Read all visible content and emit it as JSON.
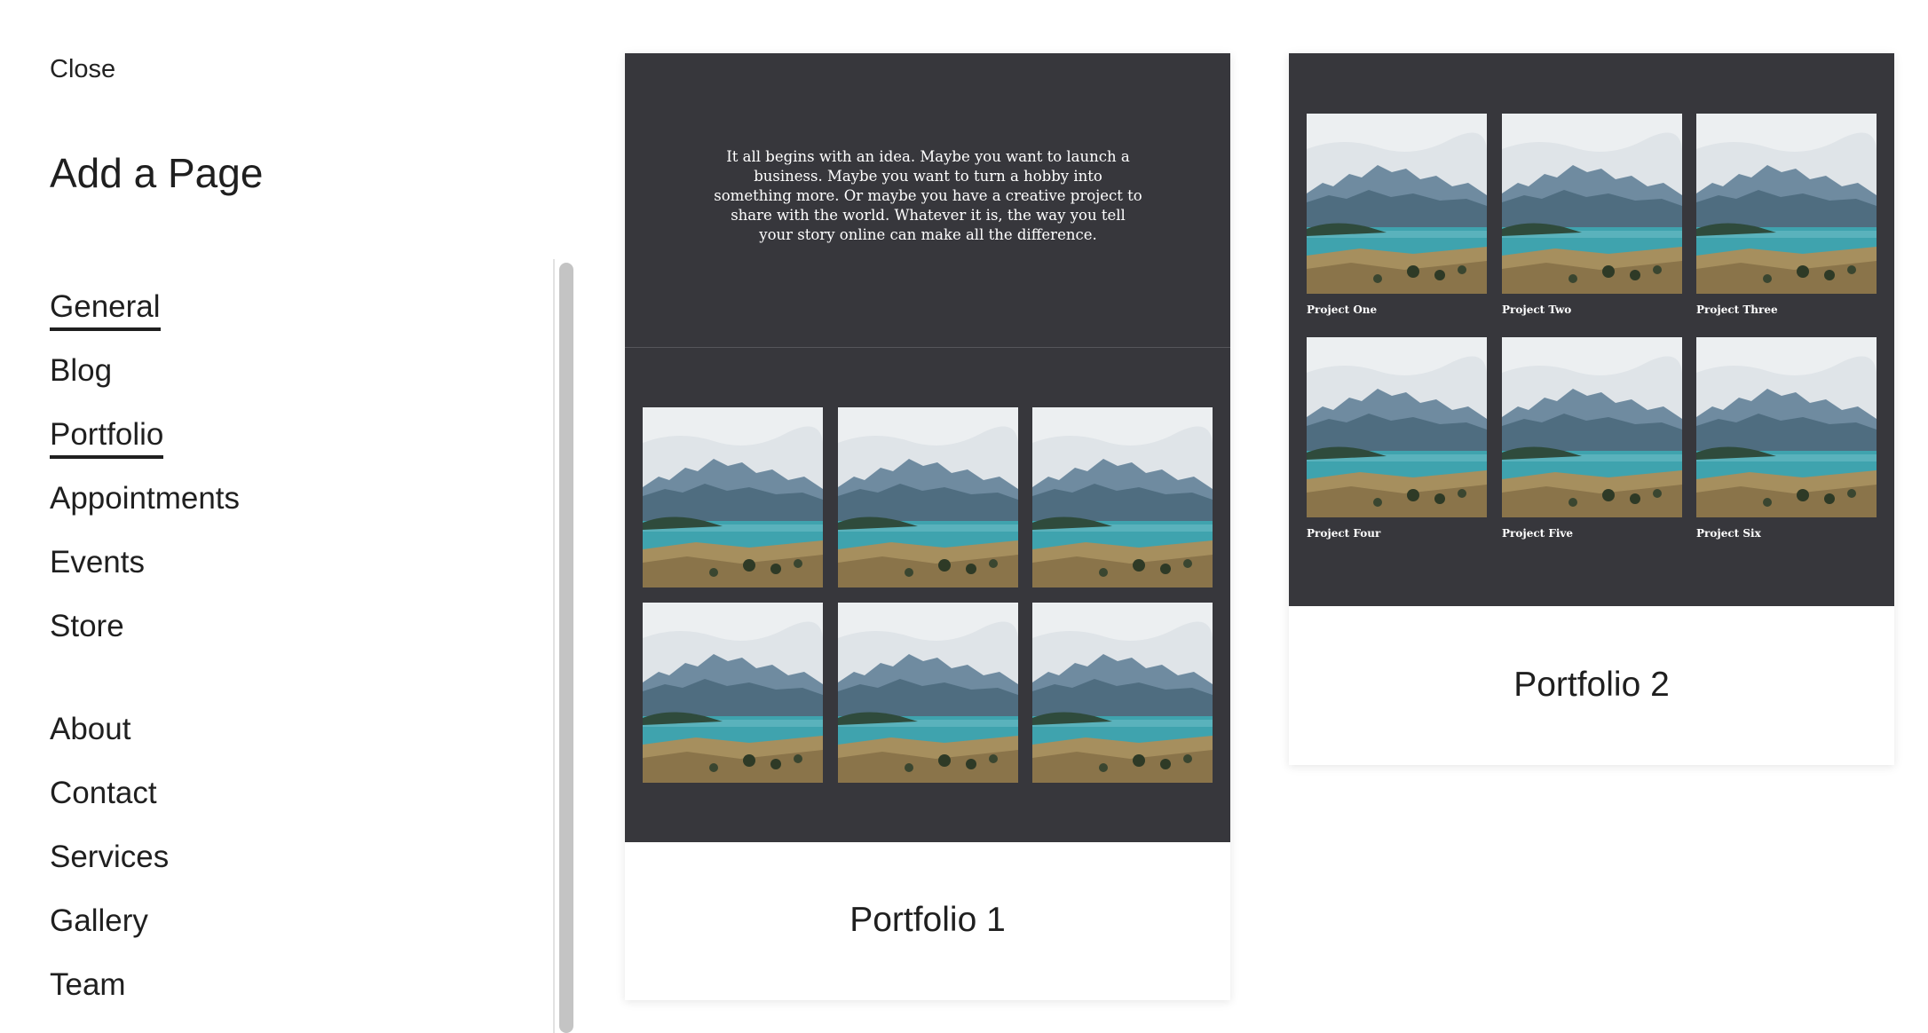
{
  "panel": {
    "close_label": "Close",
    "heading": "Add a Page",
    "nav_items": [
      {
        "label": "General"
      },
      {
        "label": "Blog"
      },
      {
        "label": "Portfolio"
      },
      {
        "label": "Appointments"
      },
      {
        "label": "Events"
      },
      {
        "label": "Store"
      },
      {
        "label": "About"
      },
      {
        "label": "Contact"
      },
      {
        "label": "Services"
      },
      {
        "label": "Gallery"
      },
      {
        "label": "Team"
      }
    ]
  },
  "templates": [
    {
      "title": "Portfolio 1",
      "intro_text": "It all begins with an idea. Maybe you want to launch a business. Maybe you want to turn a hobby into something more. Or maybe you have a creative project to share with the world. Whatever it is, the way you tell your story online can make all the difference.",
      "thumbnail_image": "mountain-lake-landscape",
      "thumbnail_count": 6
    },
    {
      "title": "Portfolio 2",
      "thumbnail_image": "mountain-lake-landscape",
      "projects": [
        "Project One",
        "Project Two",
        "Project Three",
        "Project Four",
        "Project Five",
        "Project Six"
      ]
    }
  ],
  "colors": {
    "preview_bg": "#37373c",
    "text": "#1f1f1f",
    "scrollbar_thumb": "#c4c4c4"
  }
}
